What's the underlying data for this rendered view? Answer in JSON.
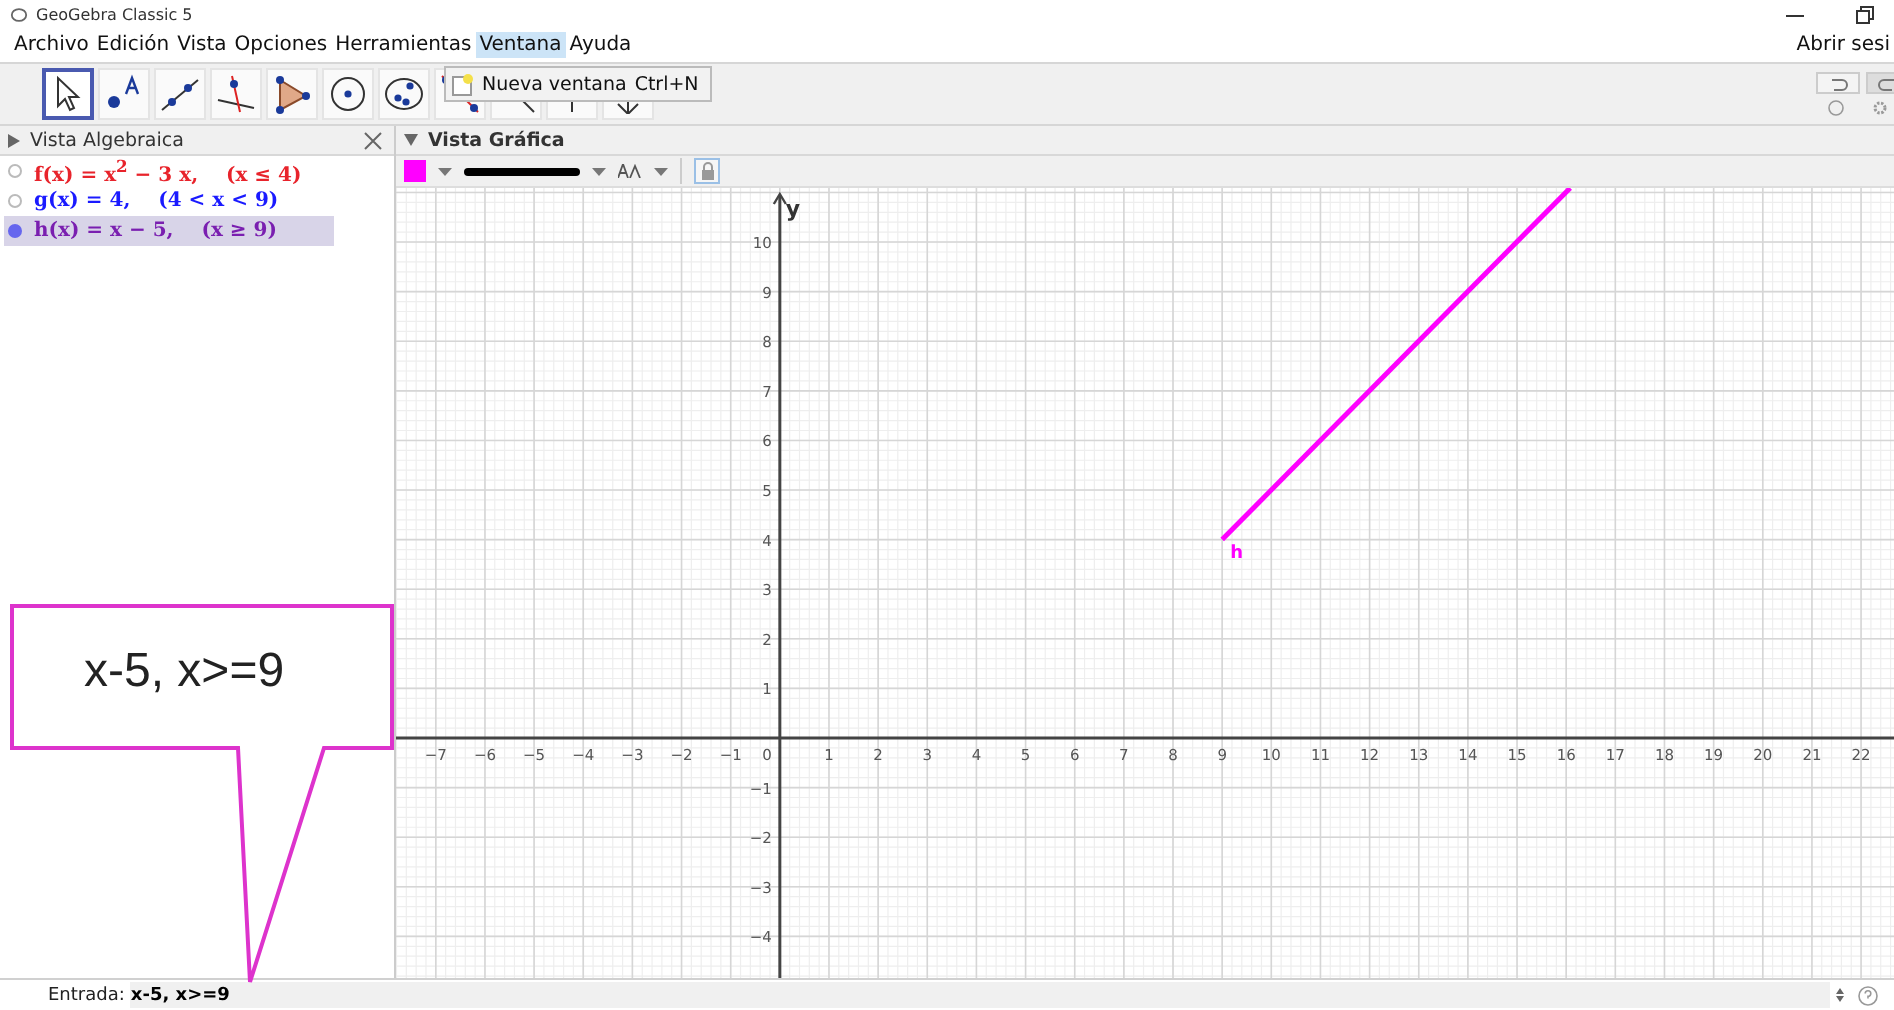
{
  "window": {
    "title": "GeoGebra Classic 5"
  },
  "menu": [
    {
      "label": "Archivo",
      "selected": false
    },
    {
      "label": "Edición",
      "selected": false
    },
    {
      "label": "Vista",
      "selected": false
    },
    {
      "label": "Opciones",
      "selected": false
    },
    {
      "label": "Herramientas",
      "selected": false
    },
    {
      "label": "Ventana",
      "selected": true
    },
    {
      "label": "Ayuda",
      "selected": false
    }
  ],
  "session_link": "Abrir sesi",
  "menu_popup": {
    "label": "Nueva ventana",
    "shortcut": "Ctrl+N"
  },
  "tools": [
    {
      "kind": "move",
      "selected": true
    },
    {
      "kind": "point",
      "selected": false
    },
    {
      "kind": "line",
      "selected": false
    },
    {
      "kind": "perpendicular",
      "selected": false
    },
    {
      "kind": "polygon",
      "selected": false
    },
    {
      "kind": "circle",
      "selected": false
    },
    {
      "kind": "conic",
      "selected": false
    },
    {
      "kind": "reflect",
      "selected": false
    },
    {
      "kind": "angle",
      "selected": false
    },
    {
      "kind": "slider",
      "selected": false
    },
    {
      "kind": "move-view",
      "selected": false
    }
  ],
  "algebra_view": {
    "title": "Vista Algebraica",
    "items": [
      {
        "text": "f(x) = x$^{2}$ − 3 x,    (x ≤ 4)",
        "color": "#e8232b",
        "visible": false,
        "selected": false
      },
      {
        "text": "g(x) = 4,    (4 < x < 9)",
        "color": "#1a1aff",
        "visible": false,
        "selected": false
      },
      {
        "text": "h(x) = x − 5,    (x ≥ 9)",
        "color": "#7a1fb0",
        "visible": true,
        "selected": true
      }
    ]
  },
  "graphics_view": {
    "title": "Vista Gráfica",
    "origin_label": "0",
    "chart_data": {
      "type": "line",
      "grid": true,
      "ylabel": "y",
      "x": [
        9,
        16.08
      ],
      "series": [
        {
          "name": "h",
          "color": "#ff00ff",
          "values": [
            4,
            11.09
          ]
        }
      ],
      "xlim": [
        -7.81,
        22.67
      ],
      "ylim": [
        -4.92,
        11.09
      ],
      "xticks": [
        -7,
        -6,
        -5,
        -4,
        -3,
        -2,
        -1,
        1,
        2,
        3,
        4,
        5,
        6,
        7,
        8,
        9,
        10,
        11,
        12,
        13,
        14,
        15,
        16,
        17,
        18,
        19,
        20,
        21,
        22
      ],
      "yticks": [
        -4,
        -3,
        -2,
        -1,
        1,
        2,
        3,
        4,
        5,
        6,
        7,
        8,
        9,
        10
      ]
    }
  },
  "input_bar": {
    "label": "Entrada:",
    "value": "x-5, x>=9"
  },
  "callout": {
    "text": "x-5, x>=9"
  }
}
